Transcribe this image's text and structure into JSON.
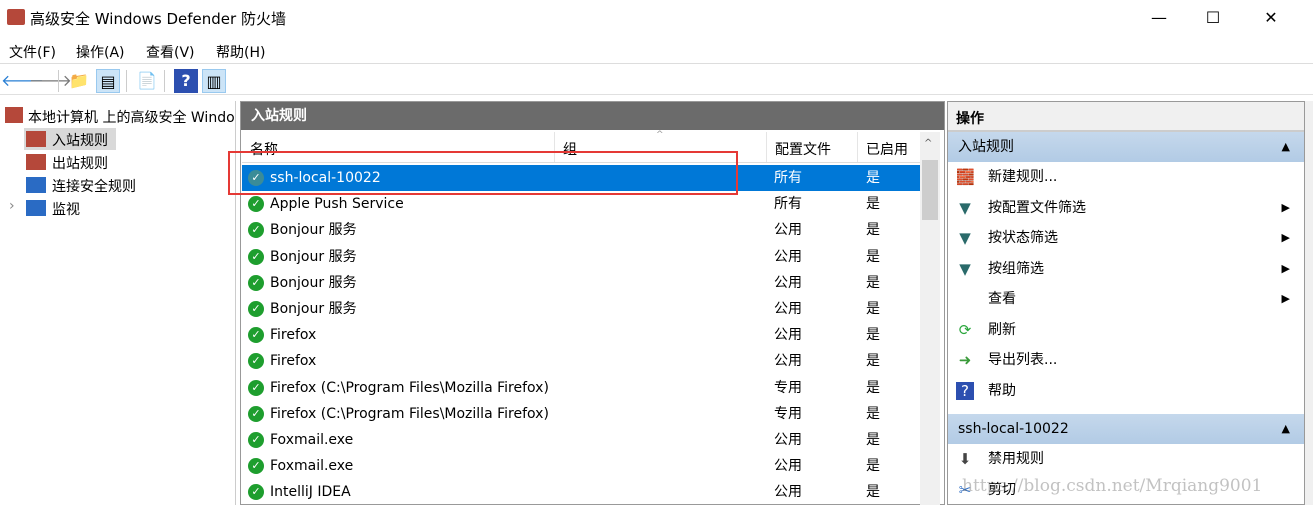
{
  "window": {
    "title": "高级安全 Windows Defender 防火墙",
    "minimize": "—",
    "maximize": "☐",
    "close": "✕"
  },
  "menu": [
    "文件(F)",
    "操作(A)",
    "查看(V)",
    "帮助(H)"
  ],
  "toolbar": {
    "back": "🡐",
    "forward": "🡒",
    "up": "📁",
    "show_hide": "▤",
    "export": "📄",
    "help": "?",
    "action_pane": "▥"
  },
  "tree": {
    "root": "本地计算机 上的高级安全 Windows Defender 防火墙",
    "items": [
      "入站规则",
      "出站规则",
      "连接安全规则",
      "监视"
    ],
    "expander": "›"
  },
  "center": {
    "title": "入站规则",
    "columns": [
      "名称",
      "组",
      "配置文件",
      "已启用"
    ],
    "rows": [
      {
        "name": "ssh-local-10022",
        "group": "",
        "profile": "所有",
        "enabled": "是"
      },
      {
        "name": "Apple Push Service",
        "group": "",
        "profile": "所有",
        "enabled": "是"
      },
      {
        "name": "Bonjour 服务",
        "group": "",
        "profile": "公用",
        "enabled": "是"
      },
      {
        "name": "Bonjour 服务",
        "group": "",
        "profile": "公用",
        "enabled": "是"
      },
      {
        "name": "Bonjour 服务",
        "group": "",
        "profile": "公用",
        "enabled": "是"
      },
      {
        "name": "Bonjour 服务",
        "group": "",
        "profile": "公用",
        "enabled": "是"
      },
      {
        "name": "Firefox",
        "group": "",
        "profile": "公用",
        "enabled": "是"
      },
      {
        "name": "Firefox",
        "group": "",
        "profile": "公用",
        "enabled": "是"
      },
      {
        "name": "Firefox (C:\\Program Files\\Mozilla Firefox)",
        "group": "",
        "profile": "专用",
        "enabled": "是"
      },
      {
        "name": "Firefox (C:\\Program Files\\Mozilla Firefox)",
        "group": "",
        "profile": "专用",
        "enabled": "是"
      },
      {
        "name": "Foxmail.exe",
        "group": "",
        "profile": "公用",
        "enabled": "是"
      },
      {
        "name": "Foxmail.exe",
        "group": "",
        "profile": "公用",
        "enabled": "是"
      },
      {
        "name": "IntelliJ IDEA",
        "group": "",
        "profile": "公用",
        "enabled": "是"
      }
    ]
  },
  "actions": {
    "title": "操作",
    "group1": {
      "title": "入站规则",
      "items": [
        {
          "label": "新建规则...",
          "icon": "new-rule-icon",
          "glyph": "🧱",
          "submenu": false
        },
        {
          "label": "按配置文件筛选",
          "icon": "filter-icon",
          "glyph": "▼",
          "submenu": true
        },
        {
          "label": "按状态筛选",
          "icon": "filter-icon",
          "glyph": "▼",
          "submenu": true
        },
        {
          "label": "按组筛选",
          "icon": "filter-icon",
          "glyph": "▼",
          "submenu": true
        },
        {
          "label": "查看",
          "icon": "",
          "glyph": "",
          "submenu": true
        },
        {
          "label": "刷新",
          "icon": "refresh-icon",
          "glyph": "⟳",
          "submenu": false
        },
        {
          "label": "导出列表...",
          "icon": "export-icon",
          "glyph": "➜",
          "submenu": false
        },
        {
          "label": "帮助",
          "icon": "help-icon",
          "glyph": "?",
          "submenu": false
        }
      ]
    },
    "group2": {
      "title": "ssh-local-10022",
      "items": [
        {
          "label": "禁用规则",
          "icon": "disable-icon",
          "glyph": "⬇",
          "submenu": false
        },
        {
          "label": "剪切",
          "icon": "cut-icon",
          "glyph": "✂",
          "submenu": false
        }
      ]
    }
  },
  "watermark": "https://blog.csdn.net/Mrqiang9001",
  "colors": {
    "selection": "#0078d7",
    "pane_header": "#6b6b6b",
    "highlight_box": "#e53935"
  }
}
